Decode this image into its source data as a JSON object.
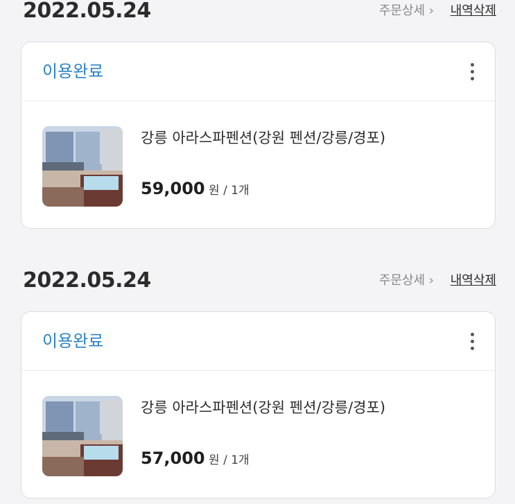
{
  "orders": [
    {
      "date": "2022.05.24",
      "detail_label": "주문상세 ›",
      "delete_label": "내역삭제",
      "status": "이용완료",
      "product_name": "강릉 아라스파펜션(강원 펜션/강릉/경포)",
      "price": "59,000",
      "price_suffix": "원 / 1개"
    },
    {
      "date": "2022.05.24",
      "detail_label": "주문상세 ›",
      "delete_label": "내역삭제",
      "status": "이용완료",
      "product_name": "강릉 아라스파펜션(강원 펜션/강릉/경포)",
      "price": "57,000",
      "price_suffix": "원 / 1개"
    }
  ],
  "icons": {
    "more": "more-vertical-icon",
    "thumbnail": "product-thumbnail"
  },
  "colors": {
    "status": "#2a83c6",
    "background": "#f4f4f6"
  }
}
